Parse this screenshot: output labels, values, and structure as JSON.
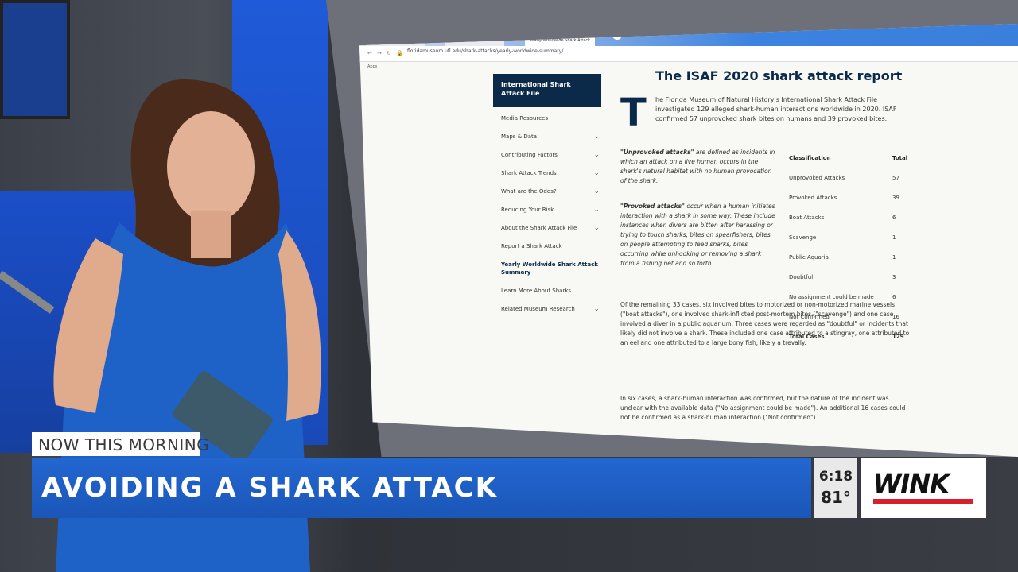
{
  "browser": {
    "tabs": [
      "CDC COVID Data Tracker",
      "CDC COVID Data Tracker",
      "Yearly Worldwide Shark Attack"
    ],
    "url": "floridamuseum.ufl.edu/shark-attacks/yearly-worldwide-summary/",
    "bookmarks_label": "Apps"
  },
  "sidebar": {
    "header": "International Shark Attack File",
    "items": [
      {
        "label": "Media Resources",
        "chevron": false
      },
      {
        "label": "Maps & Data",
        "chevron": true
      },
      {
        "label": "Contributing Factors",
        "chevron": true
      },
      {
        "label": "Shark Attack Trends",
        "chevron": true
      },
      {
        "label": "What are the Odds?",
        "chevron": true
      },
      {
        "label": "Reducing Your Risk",
        "chevron": true
      },
      {
        "label": "About the Shark Attack File",
        "chevron": true
      },
      {
        "label": "Report a Shark Attack",
        "chevron": false
      },
      {
        "label": "Yearly Worldwide Shark Attack Summary",
        "chevron": false,
        "active": true
      },
      {
        "label": "Learn More About Sharks",
        "chevron": false
      },
      {
        "label": "Related Museum Research",
        "chevron": true
      }
    ]
  },
  "article": {
    "title": "The ISAF 2020 shark attack report",
    "dropcap": "T",
    "intro": "he Florida Museum of Natural History's International Shark Attack File investigated 129 alleged shark-human interactions worldwide in 2020. ISAF confirmed 57 unprovoked shark bites on humans and 39 provoked bites.",
    "unprovoked_term": "\"Unprovoked attacks\"",
    "unprovoked_def": "are defined as incidents in which an attack on a live human occurs in the shark's natural habitat with no human provocation of the shark.",
    "provoked_term": "\"Provoked attacks\"",
    "provoked_def": "occur when a human initiates interaction with a shark in some way. These include instances when divers are bitten after harassing or trying to touch sharks, bites on spearfishers, bites on people attempting to feed sharks, bites occurring while unhooking or removing a shark from a fishing net and so forth.",
    "remaining": "Of the remaining 33 cases, six involved bites to motorized or non-motorized marine vessels (\"boat attacks\"), one involved shark-inflicted post-mortem bites (\"scavenge\") and one case involved a diver in a public aquarium. Three cases were regarded as \"doubtful\" or incidents that likely did not involve a shark. These included one case attributed to a stingray, one attributed to an eel and one attributed to a large bony fish, likely a trevally.",
    "six_cases": "In six cases, a shark-human interaction was confirmed, but the nature of the incident was unclear with the available data (\"No assignment could be made\"). An additional 16 cases could not be confirmed as a shark-human interaction (\"Not confirmed\")."
  },
  "table": {
    "header": [
      "Classification",
      "Total"
    ],
    "rows": [
      [
        "Unprovoked Attacks",
        "57"
      ],
      [
        "Provoked Attacks",
        "39"
      ],
      [
        "Boat Attacks",
        "6"
      ],
      [
        "Scavenge",
        "1"
      ],
      [
        "Public Aquaria",
        "1"
      ],
      [
        "Doubtful",
        "3"
      ],
      [
        "No assignment could be made",
        "6"
      ],
      [
        "Not Confirmed",
        "16"
      ]
    ],
    "total": [
      "Total Cases",
      "129"
    ]
  },
  "lower_third": {
    "kicker": "NOW THIS MORNING",
    "headline": "AVOIDING A SHARK ATTACK",
    "time": "6:18",
    "temp": "81°",
    "station": "WINK"
  },
  "colors": {
    "headline_blue": "#1f5fcc",
    "navy": "#0b2a4a",
    "logo_red": "#d6202b"
  }
}
